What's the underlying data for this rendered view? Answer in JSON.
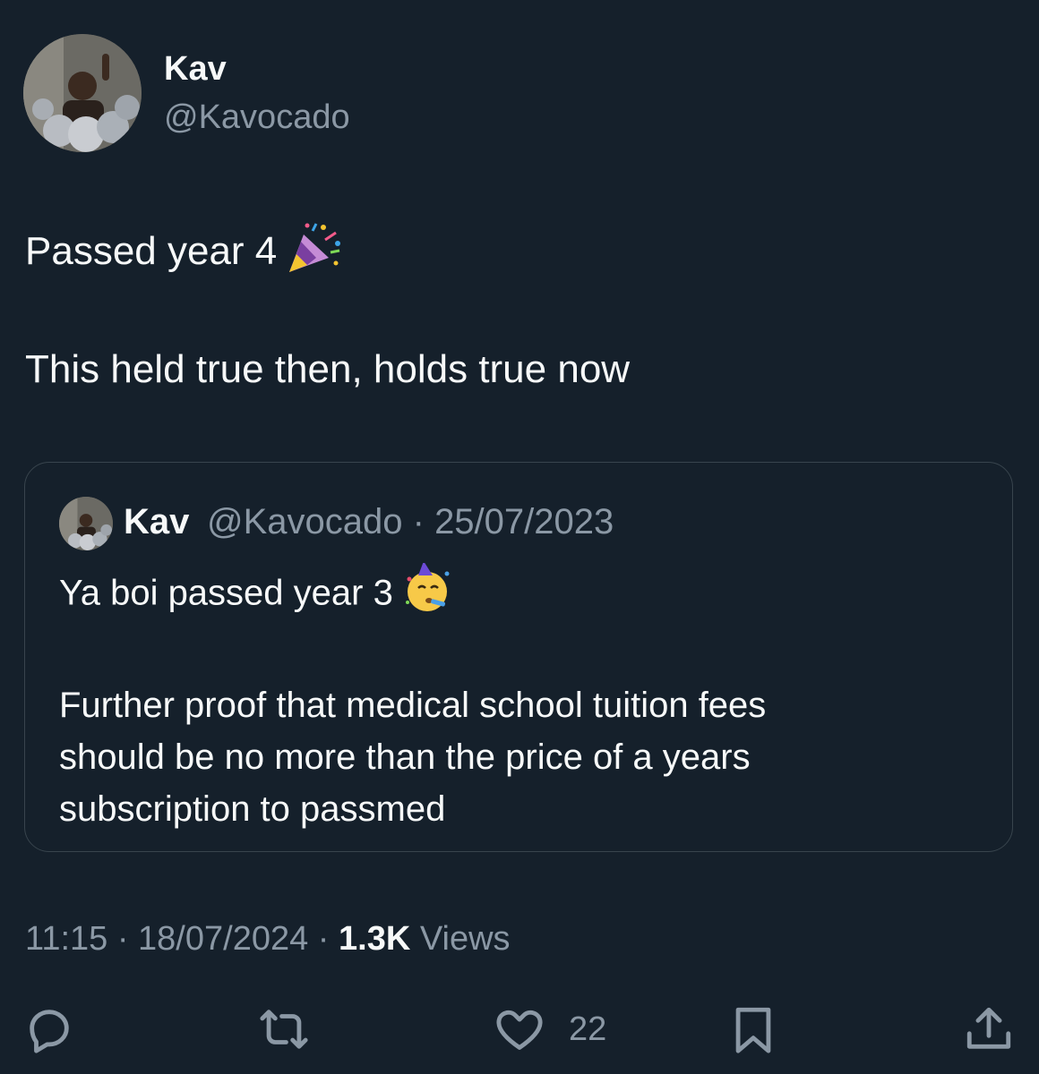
{
  "tweet": {
    "author_name": "Kav",
    "author_handle": "@Kavocado",
    "line1": "Passed year 4",
    "line2": "This held true then, holds true now",
    "line1_emoji": "party-popper-emoji"
  },
  "quote": {
    "author_name": "Kav",
    "meta": "@Kavocado · 25/07/2023",
    "line1": "Ya boi passed year 3",
    "line1_emoji": "partying-face-emoji",
    "paragraph": [
      "Further proof that medical school tuition fees",
      "should be no more than the price of a years",
      "subscription to passmed"
    ]
  },
  "meta": {
    "time_date": "11:15 · 18/07/2024 · ",
    "views_count": "1.3K",
    "views_label": " Views"
  },
  "actions": {
    "like_count": "22",
    "icons": [
      "reply-icon",
      "retweet-icon",
      "like-icon",
      "bookmark-icon",
      "share-icon"
    ]
  },
  "colors": {
    "background": "#15202b",
    "text": "#f7f9f9",
    "secondary": "#8b98a5",
    "border": "#38444d"
  }
}
